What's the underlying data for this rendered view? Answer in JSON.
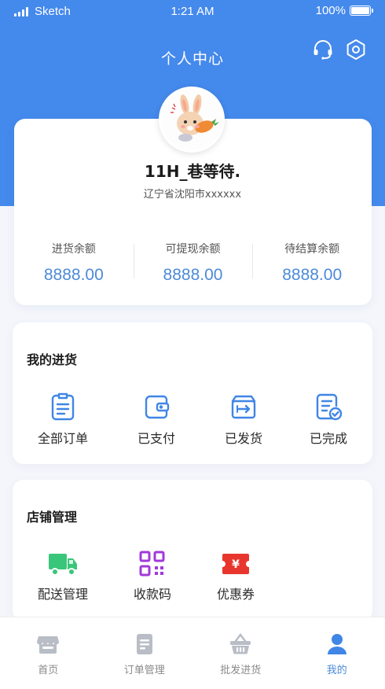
{
  "status_bar": {
    "carrier": "Sketch",
    "time": "1:21 AM",
    "battery": "100%"
  },
  "header": {
    "title": "个人中心",
    "support_icon": "headset-icon",
    "settings_icon": "settings-icon"
  },
  "profile": {
    "name": "11H_巷等待.",
    "address": "辽宁省沈阳市xxxxxx",
    "balances": [
      {
        "label": "进货余额",
        "value": "8888.00"
      },
      {
        "label": "可提现余额",
        "value": "8888.00"
      },
      {
        "label": "待结算余额",
        "value": "8888.00"
      }
    ]
  },
  "purchases": {
    "title": "我的进货",
    "items": [
      {
        "label": "全部订单",
        "icon": "order-list-icon"
      },
      {
        "label": "已支付",
        "icon": "wallet-icon"
      },
      {
        "label": "已发货",
        "icon": "shipped-box-icon"
      },
      {
        "label": "已完成",
        "icon": "completed-doc-icon"
      }
    ]
  },
  "store": {
    "title": "店铺管理",
    "items": [
      {
        "label": "配送管理",
        "icon": "delivery-truck-icon"
      },
      {
        "label": "收款码",
        "icon": "qr-code-icon"
      },
      {
        "label": "优惠券",
        "icon": "coupon-icon"
      }
    ]
  },
  "tab_bar": {
    "tabs": [
      {
        "label": "首页",
        "icon": "store-icon"
      },
      {
        "label": "订单管理",
        "icon": "order-doc-icon"
      },
      {
        "label": "批发进货",
        "icon": "basket-icon"
      },
      {
        "label": "我的",
        "icon": "user-icon"
      }
    ],
    "active_tab": "我的"
  },
  "colors": {
    "primary": "#4489ec",
    "accent_text": "#4c8ad8",
    "truck_green": "#39c67a",
    "qr_purple": "#a13ad8",
    "coupon_red": "#e8362e",
    "tab_inactive": "#b8bdc6"
  }
}
